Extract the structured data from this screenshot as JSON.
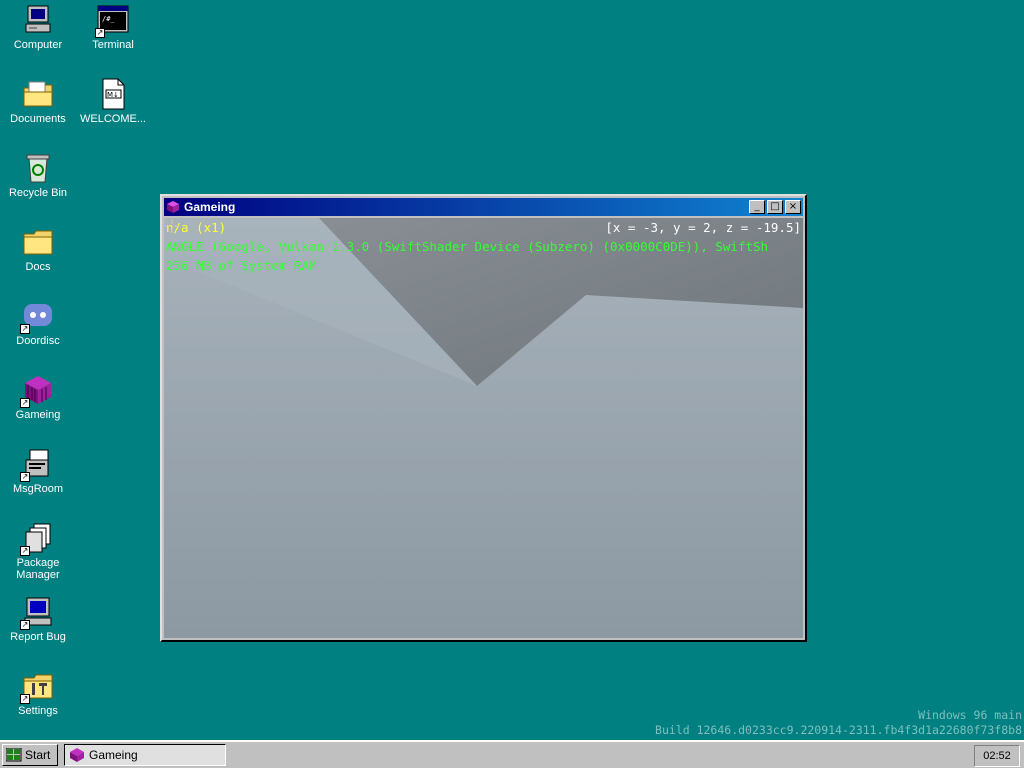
{
  "desktop": {
    "icons": [
      {
        "label": "Computer",
        "icon": "computer-icon"
      },
      {
        "label": "Terminal",
        "icon": "terminal-icon"
      },
      {
        "label": "Documents",
        "icon": "documents-folder-icon"
      },
      {
        "label": "WELCOME...",
        "icon": "markdown-file-icon"
      },
      {
        "label": "Recycle Bin",
        "icon": "recycle-bin-icon"
      },
      {
        "label": "Docs",
        "icon": "folder-icon"
      },
      {
        "label": "Doordisc",
        "icon": "doordisc-icon"
      },
      {
        "label": "Gameing",
        "icon": "gameing-cube-icon"
      },
      {
        "label": "MsgRoom",
        "icon": "msgroom-icon"
      },
      {
        "label": "Package Manager",
        "icon": "package-manager-icon"
      },
      {
        "label": "Report Bug",
        "icon": "report-bug-icon"
      },
      {
        "label": "Settings",
        "icon": "settings-icon"
      }
    ]
  },
  "window": {
    "title": "Gameing",
    "buttons": {
      "minimize": "_",
      "maximize": "□",
      "close": "×"
    },
    "hud": {
      "fps": "n/a (x1)",
      "coords": "[x = -3, y = 2, z = -19.5]",
      "gpu": "ANGLE (Google, Vulkan 1.3.0 (SwiftShader Device (Subzero) (0x0000C0DE)), SwiftSh",
      "ram": "256 MB of System RAM"
    }
  },
  "watermark": {
    "line1": "Windows 96 main",
    "line2": "Build 12646.d0233cc9.220914-2311.fb4f3d1a22680f73f8b8"
  },
  "taskbar": {
    "start_label": "Start",
    "task_label": "Gameing",
    "clock": "02:52"
  },
  "colors": {
    "desktop": "#008080",
    "titlebar": "#000080",
    "hud_yellow": "#ffff33",
    "hud_green": "#33ff33"
  }
}
